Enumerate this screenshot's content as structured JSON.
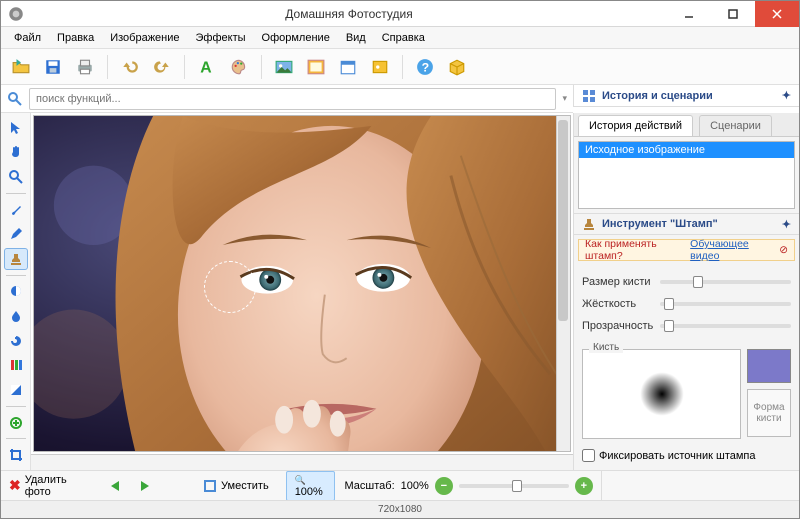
{
  "title": "Домашняя Фотостудия",
  "menu": [
    "Файл",
    "Правка",
    "Изображение",
    "Эффекты",
    "Оформление",
    "Вид",
    "Справка"
  ],
  "search": {
    "placeholder": "поиск функций..."
  },
  "right": {
    "history_title": "История и сценарии",
    "tabs": [
      "История действий",
      "Сценарии"
    ],
    "history_items": [
      "Исходное изображение"
    ],
    "instrument_title": "Инструмент \"Штамп\"",
    "hint_label": "Как применять штамп?",
    "hint_link": "Обучающее видео",
    "sliders": [
      {
        "label": "Размер кисти",
        "pos": 0.25
      },
      {
        "label": "Жёсткость",
        "pos": 0.03
      },
      {
        "label": "Прозрачность",
        "pos": 0.03
      }
    ],
    "brush_label": "Кисть",
    "shape_label": "Форма кисти",
    "fix_source": "Фиксировать источник штампа"
  },
  "bottom": {
    "delete": "Удалить фото",
    "fit": "Уместить",
    "z100": "100%",
    "scale_label": "Масштаб:",
    "scale_value": "100%"
  },
  "status": {
    "dim": "720x1080"
  }
}
